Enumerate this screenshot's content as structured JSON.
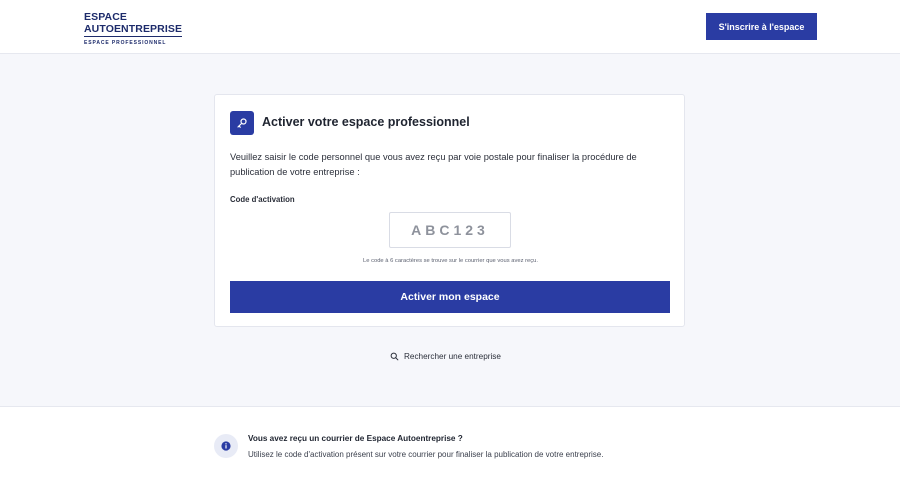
{
  "header": {
    "logo_line1": "ESPACE",
    "logo_line2": "AUTOENTREPRISE",
    "logo_sub": "ESPACE PROFESSIONNEL",
    "register_label": "S'inscrire à l'espace"
  },
  "card": {
    "icon": "key-icon",
    "title": "Activer votre espace professionnel",
    "description": "Veuillez saisir le code personnel que vous avez reçu par voie postale pour finaliser la procédure de publication de votre entreprise :",
    "field_label": "Code d'activation",
    "code_placeholder": "ABC123",
    "code_value": "",
    "hint": "Le code à 6 caractères se trouve sur le courrier que vous avez reçu.",
    "submit_label": "Activer mon espace"
  },
  "search_link": {
    "icon": "search-icon",
    "label": "Rechercher une entreprise"
  },
  "footer": {
    "icon": "info-icon",
    "title": "Vous avez reçu un courrier de Espace Autoentreprise ?",
    "text": "Utilisez le code d'activation présent sur votre courrier pour finaliser la publication de votre entreprise."
  },
  "colors": {
    "brand": "#2a3ca3",
    "logo": "#1d2b6b",
    "background": "#f6f7fb"
  }
}
